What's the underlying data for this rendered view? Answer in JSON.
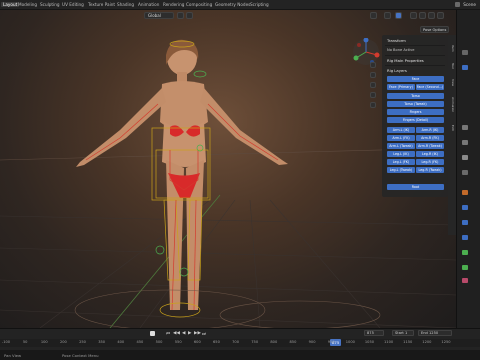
{
  "topbar": {
    "tabs": [
      "Layout",
      "Modeling",
      "Sculpting",
      "UV Editing",
      "Texture Paint",
      "Shading",
      "Animation",
      "Rendering",
      "Compositing",
      "Geometry Nodes",
      "Scripting"
    ],
    "active_tab": "Layout",
    "scene_label": "Scene"
  },
  "viewport": {
    "pivot_label": "Global",
    "pose_options_label": "Pose Options"
  },
  "npanel": {
    "transform": "Transform",
    "no_bone": "No Bone Active",
    "rig_main": "Rig Main Properties",
    "rig_layers": "Rig Layers",
    "layers": {
      "face": "Face",
      "face_primary": "Face (Primary)",
      "face_secondary": "Face (Second...)",
      "torso": "Torso",
      "torso_tweak": "Torso (Tweak)",
      "fingers": "Fingers",
      "fingers_detail": "Fingers (Detail)",
      "arm_l_ik": "Arm.L (IK)",
      "arm_r_ik": "Arm.R (IK)",
      "arm_l_fk": "Arm.L (FK)",
      "arm_r_fk": "Arm.R (FK)",
      "arm_l_tweak": "Arm.L (Tweak)",
      "arm_r_tweak": "Arm.R (Tweak)",
      "leg_l_ik": "Leg.L (IK)",
      "leg_r_ik": "Leg.R (IK)",
      "leg_l_fk": "Leg.L (FK)",
      "leg_r_fk": "Leg.R (FK)",
      "leg_l_tweak": "Leg.L (Tweak)",
      "leg_r_tweak": "Leg.R (Tweak)",
      "root": "Root"
    },
    "tabs": [
      "Item",
      "Tool",
      "View",
      "Animation",
      "Edit"
    ]
  },
  "timeline": {
    "current_frame": "875",
    "start_label": "Start",
    "start_value": "1",
    "end_label": "End",
    "end_value": "1250",
    "frame_field": "875",
    "ruler": [
      "-100",
      "50",
      "100",
      "200",
      "250",
      "350",
      "400",
      "450",
      "500",
      "550",
      "600",
      "650",
      "700",
      "750",
      "800",
      "850",
      "900",
      "950",
      "1000",
      "1050",
      "1100",
      "1150",
      "1200",
      "1250"
    ]
  },
  "statusbar": {
    "left": "Pan View",
    "right": "Pose Context Menu"
  },
  "colors": {
    "accent": "#3d6ec3",
    "bone_red": "#d33b2e",
    "bone_yellow": "#c9a21a",
    "bone_green": "#4caf50"
  }
}
